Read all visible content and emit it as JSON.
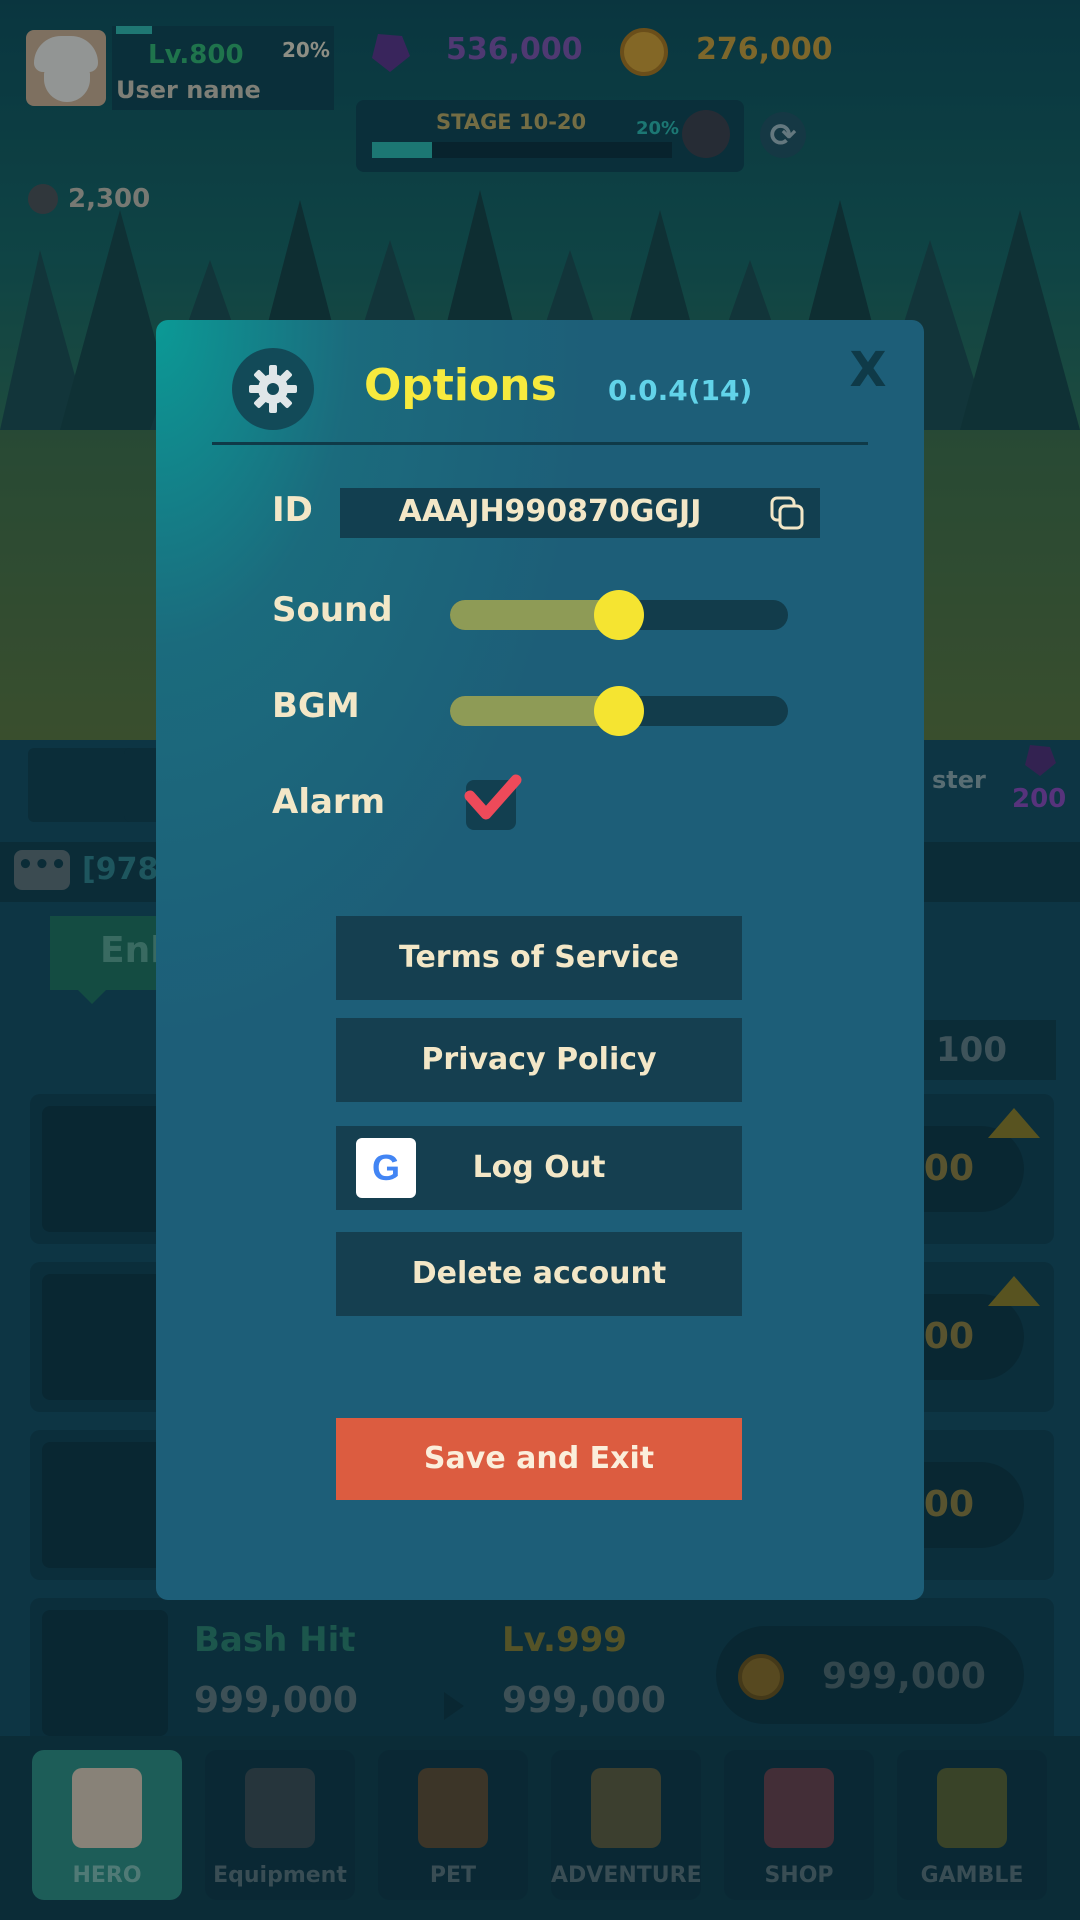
{
  "hud": {
    "level": "Lv.800",
    "level_percent": "20%",
    "username": "User name",
    "gems": "536,000",
    "coins": "276,000",
    "stage": "STAGE 10-20",
    "stage_percent": "20%",
    "stage_progress": 0.2,
    "kills": "2,300"
  },
  "background": {
    "side_label": "ster",
    "side_gem_count": "200",
    "chat_text": "[978I",
    "enhance_tab": "Enh",
    "quantity": "100",
    "row_costs": [
      "00",
      "00",
      "00"
    ],
    "skill": {
      "name": "Bash Hit",
      "level": "Lv.999",
      "current": "999,000",
      "next": "999,000",
      "cost": "999,000"
    }
  },
  "nav": [
    {
      "label": "HERO",
      "icon": "hero-icon"
    },
    {
      "label": "Equipment",
      "icon": "axe-icon"
    },
    {
      "label": "PET",
      "icon": "pet-icon"
    },
    {
      "label": "ADVENTURE",
      "icon": "map-icon"
    },
    {
      "label": "SHOP",
      "icon": "bag-icon"
    },
    {
      "label": "GAMBLE",
      "icon": "dice-icon"
    }
  ],
  "options": {
    "title": "Options",
    "version": "0.0.4(14)",
    "close": "X",
    "id_label": "ID",
    "id_value": "AAAJH990870GGJJ",
    "sound_label": "Sound",
    "sound_level": 0.5,
    "bgm_label": "BGM",
    "bgm_level": 0.5,
    "alarm_label": "Alarm",
    "alarm_checked": true,
    "terms": "Terms of Service",
    "privacy": "Privacy Policy",
    "logout": "Log Out",
    "google_glyph": "G",
    "delete": "Delete account",
    "save": "Save and Exit"
  },
  "colors": {
    "accent_yellow": "#f7ea3e",
    "version_cyan": "#62d3e9",
    "modal_bg": "#1d5e78",
    "save_red": "#dc5c40",
    "check_red": "#ee4a5a"
  }
}
